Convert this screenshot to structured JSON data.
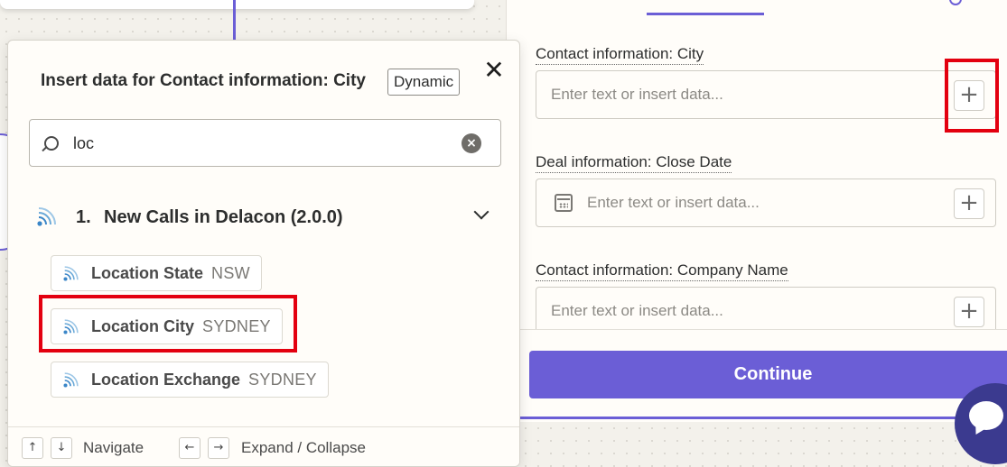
{
  "popover": {
    "title": "Insert data for Contact information: City",
    "badge": "Dynamic",
    "close_glyph": "✕",
    "search": {
      "value": "loc",
      "placeholder": ""
    },
    "step": {
      "number": "1.",
      "name": "New Calls in Delacon (2.0.0)",
      "icon": "signal-icon"
    },
    "items": [
      {
        "label": "Location State",
        "value": "NSW"
      },
      {
        "label": "Location City",
        "value": "SYDNEY"
      },
      {
        "label": "Location Exchange",
        "value": "SYDNEY"
      }
    ],
    "footer": {
      "navigate_up": "↑",
      "navigate_down": "↓",
      "navigate_label": "Navigate",
      "expand_left": "←",
      "expand_right": "→",
      "expand_label": "Expand / Collapse"
    }
  },
  "fields": [
    {
      "label": "Contact information: City",
      "placeholder": "Enter text or insert data...",
      "icon": null
    },
    {
      "label": "Deal information: Close Date",
      "placeholder": "Enter text or insert data...",
      "icon": "calendar-icon"
    },
    {
      "label": "Contact information: Company Name",
      "placeholder": "Enter text or insert data...",
      "icon": null
    }
  ],
  "plus_glyph": "+",
  "continue_label": "Continue",
  "colors": {
    "accent": "#6b5ed6",
    "highlight": "#e3000f",
    "chat": "#3b3a8f"
  }
}
